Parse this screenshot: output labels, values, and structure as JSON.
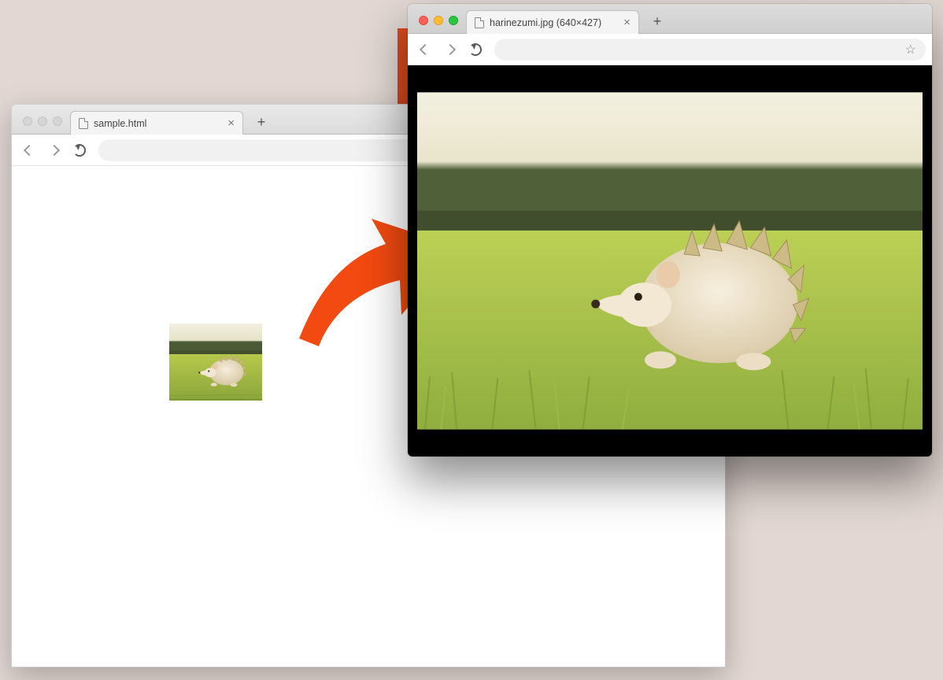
{
  "window1": {
    "tab_title": "sample.html",
    "tab_close_glyph": "×",
    "new_tab_glyph": "+",
    "address_value": ""
  },
  "window2": {
    "tab_title": "harinezumi.jpg (640×427)",
    "tab_close_glyph": "×",
    "new_tab_glyph": "+",
    "address_value": "",
    "star_glyph": "☆"
  },
  "arrow": {
    "color": "#f24a10"
  }
}
